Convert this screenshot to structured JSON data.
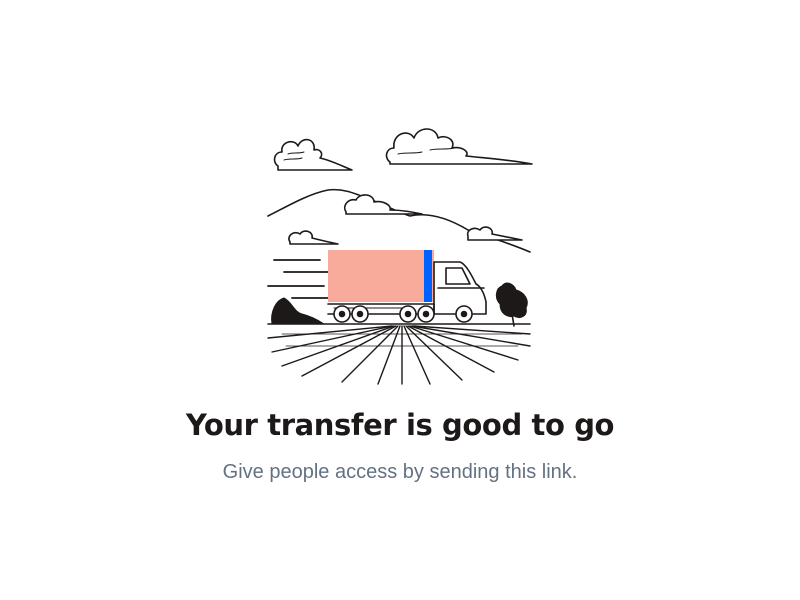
{
  "success": {
    "title": "Your transfer is good to go",
    "subtitle": "Give people access by sending this link."
  },
  "illustration": {
    "icon": "truck-illustration",
    "colors": {
      "cargo": "#f9ab9b",
      "stripe": "#0061fe",
      "ink": "#1e1919"
    }
  }
}
